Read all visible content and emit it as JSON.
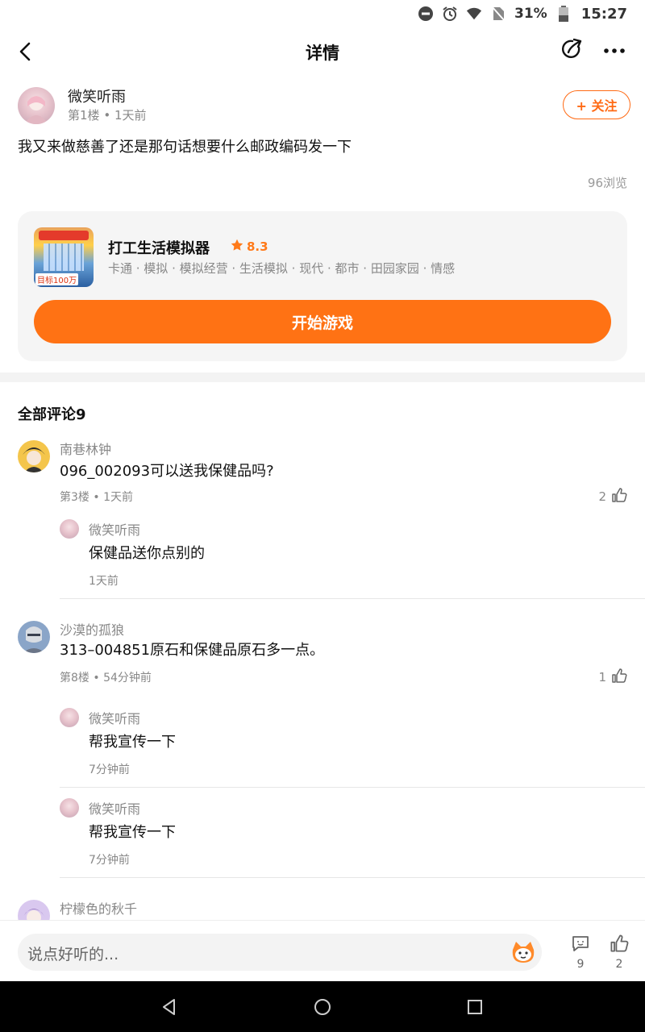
{
  "status_bar": {
    "battery": "31%",
    "time": "15:27"
  },
  "header": {
    "title": "详情"
  },
  "post": {
    "author": "微笑听雨",
    "floor": "第1楼",
    "time": "1天前",
    "follow_label": "+ 关注",
    "content": "我又来做慈善了还是那句话想要什么邮政编码发一下",
    "views": "96浏览"
  },
  "game": {
    "title": "打工生活模拟器",
    "rating": "8.3",
    "tags": "卡通 · 模拟 · 模拟经营 · 生活模拟 · 现代 · 都市 · 田园家园 · 情感",
    "play_label": "开始游戏",
    "thumb_tag": "目标100万"
  },
  "comments": {
    "title": "全部评论9",
    "items": [
      {
        "name": "南巷林钟",
        "text": "096_002093可以送我保健品吗?",
        "meta": "第3楼 • 1天前",
        "likes": "2",
        "replies": [
          {
            "name": "微笑听雨",
            "text": "保健品送你点别的",
            "meta": "1天前"
          }
        ]
      },
      {
        "name": "沙漠的孤狼",
        "text": "313–004851原石和保健品原石多一点。",
        "meta": "第8楼 • 54分钟前",
        "likes": "1",
        "replies": [
          {
            "name": "微笑听雨",
            "text": "帮我宣传一下",
            "meta": "7分钟前"
          },
          {
            "name": "微笑听雨",
            "text": "帮我宣传一下",
            "meta": "7分钟前"
          }
        ]
      },
      {
        "name": "柠檬色的秋千"
      }
    ]
  },
  "bottom_bar": {
    "placeholder": "说点好听的...",
    "comment_count": "9",
    "like_count": "2"
  },
  "colors": {
    "accent": "#ff7214"
  }
}
